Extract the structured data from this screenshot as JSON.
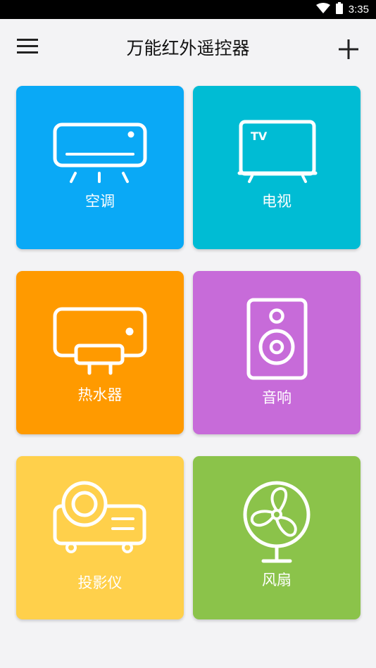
{
  "status_bar": {
    "time": "3:35",
    "icons": [
      "wifi-icon",
      "battery-icon"
    ]
  },
  "app_bar": {
    "title": "万能红外遥控器",
    "menu_icon": "hamburger-menu-icon",
    "add_icon": "plus-icon"
  },
  "devices": [
    {
      "label": "空调",
      "icon": "air-conditioner-icon",
      "color": "#0aa9f6"
    },
    {
      "label": "电视",
      "icon": "tv-icon",
      "color": "#00bcd4"
    },
    {
      "label": "热水器",
      "icon": "water-heater-icon",
      "color": "#ff9a00"
    },
    {
      "label": "音响",
      "icon": "speaker-icon",
      "color": "#c76bd9"
    },
    {
      "label": "投影仪",
      "icon": "projector-icon",
      "color": "#ffd04b"
    },
    {
      "label": "风扇",
      "icon": "fan-icon",
      "color": "#8bc34a"
    }
  ]
}
